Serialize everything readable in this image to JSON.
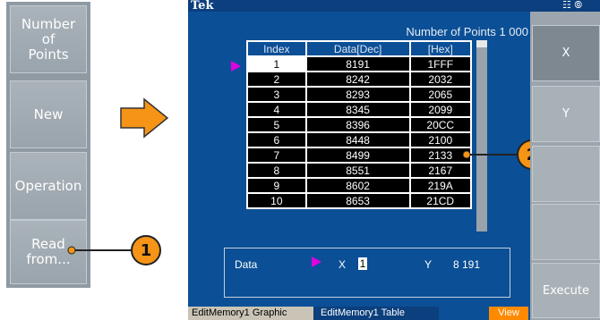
{
  "left_panel": {
    "buttons": [
      {
        "label": "Number of Points",
        "lines": [
          "Number",
          "of",
          "Points"
        ]
      },
      {
        "label": "New",
        "lines": [
          "New"
        ]
      },
      {
        "label": "Operation",
        "lines": [
          "Operation"
        ]
      },
      {
        "label": "Read from...",
        "lines": [
          "Read",
          "from..."
        ]
      }
    ]
  },
  "screen": {
    "brand": "Tek",
    "number_of_points_label": "Number of Points 1 000",
    "table": {
      "headers": [
        "Index",
        "Data[Dec]",
        "[Hex]"
      ],
      "rows": [
        [
          "1",
          "8191",
          "1FFF"
        ],
        [
          "2",
          "8242",
          "2032"
        ],
        [
          "3",
          "8293",
          "2065"
        ],
        [
          "4",
          "8345",
          "2099"
        ],
        [
          "5",
          "8396",
          "20CC"
        ],
        [
          "6",
          "8448",
          "2100"
        ],
        [
          "7",
          "8499",
          "2133"
        ],
        [
          "8",
          "8551",
          "2167"
        ],
        [
          "9",
          "8602",
          "219A"
        ],
        [
          "10",
          "8653",
          "21CD"
        ]
      ],
      "selected_row": 1
    },
    "data_box": {
      "label": "Data",
      "x_label": "X",
      "x_value": "1",
      "y_label": "Y",
      "y_value": "8 191"
    },
    "tabs": {
      "tab1": "EditMemory1 Graphic",
      "tab2": "EditMemory1 Table",
      "view": "View"
    }
  },
  "right_panel": {
    "buttons": [
      "X",
      "Y",
      "",
      "",
      "Execute"
    ]
  },
  "callouts": [
    "1",
    "2"
  ],
  "colors": {
    "screen_bg": "#0b4f96",
    "callout": "#f59416",
    "marker": "#e000e0",
    "view_tab": "#ff8a00"
  },
  "icons": {
    "arrow": "right-arrow-icon",
    "marker": "triangle-marker-icon",
    "status": "status-icons"
  }
}
